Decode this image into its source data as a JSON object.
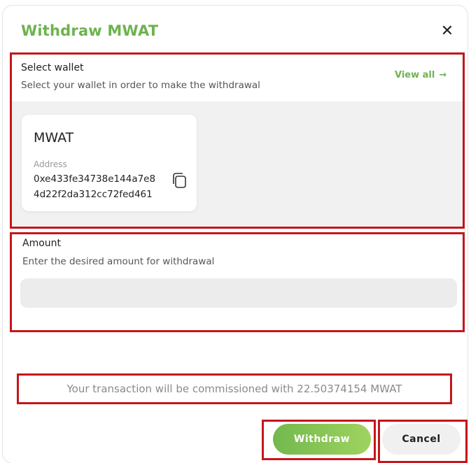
{
  "dialog": {
    "title": "Withdraw MWAT",
    "close_icon": "close-icon"
  },
  "wallet_section": {
    "label": "Select wallet",
    "hint": "Select your wallet in order to make the withdrawal",
    "view_all": "View all",
    "view_all_arrow": "→",
    "wallet": {
      "name": "MWAT",
      "address_label": "Address",
      "address_line1": "0xe433fe34738e144a7e8",
      "address_line2": "4d22f2da312cc72fed461",
      "copy_icon": "copy-icon"
    }
  },
  "amount_section": {
    "label": "Amount",
    "hint": "Enter the desired amount for withdrawal",
    "value": ""
  },
  "commission_text": "Your transaction will be commissioned with 22.50374154 MWAT",
  "actions": {
    "withdraw": "Withdraw",
    "cancel": "Cancel"
  },
  "colors": {
    "accent": "#6db34f",
    "highlight_border": "#c4161c"
  }
}
